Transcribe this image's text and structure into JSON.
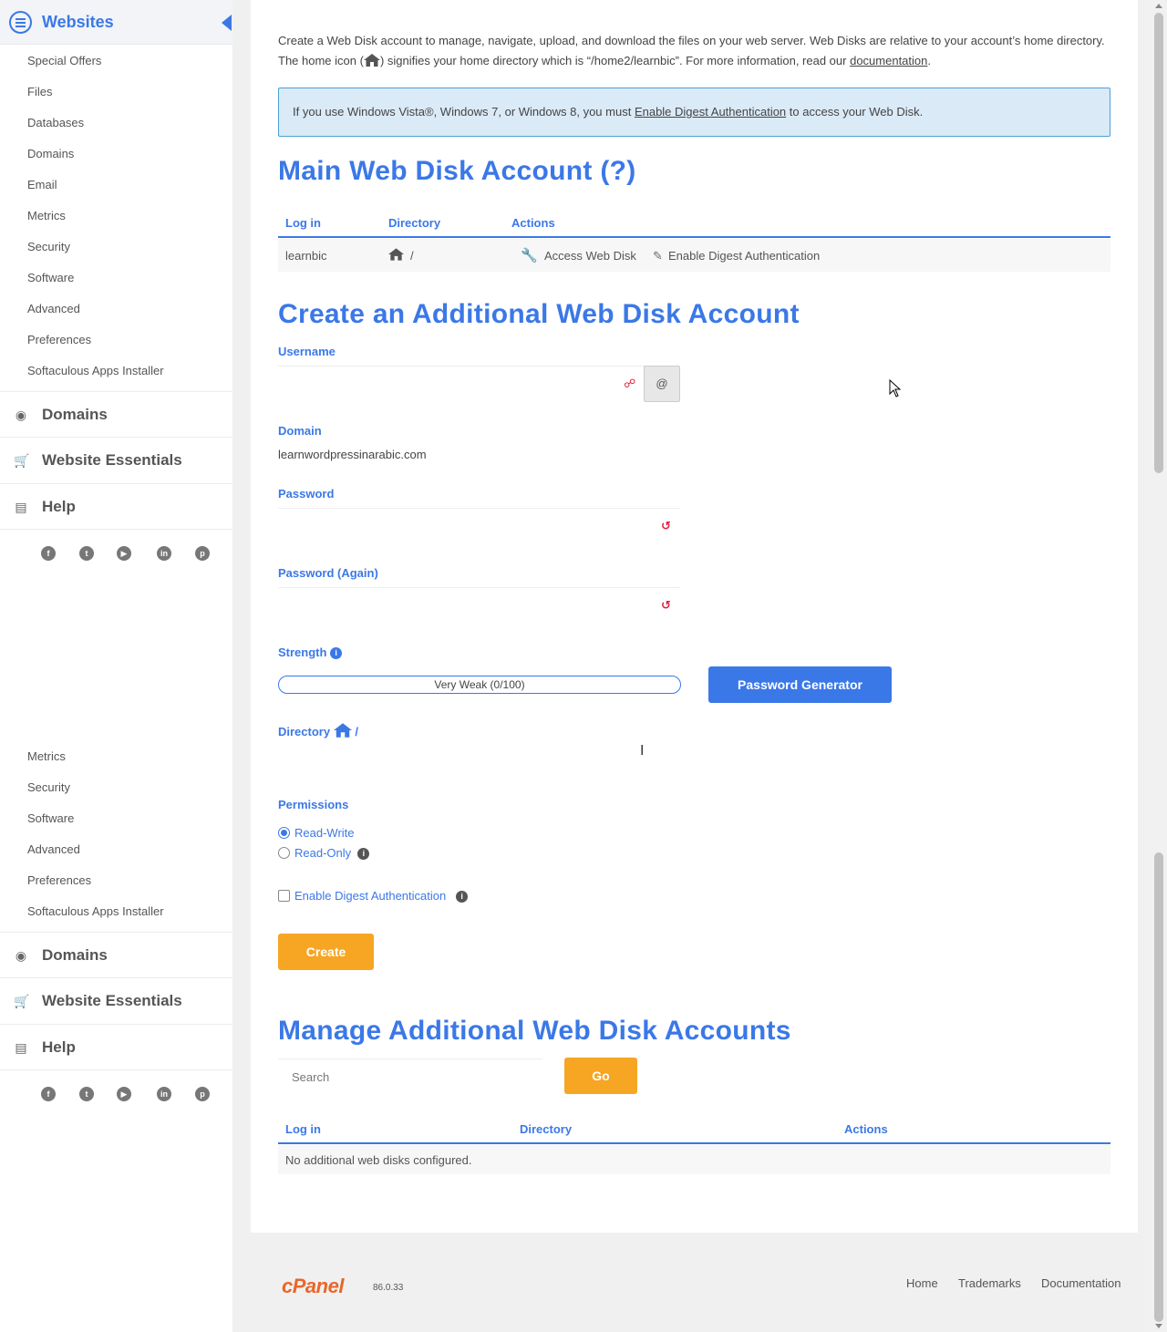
{
  "sidebar": {
    "header_title": "Websites",
    "sub_items_top": [
      "Special Offers",
      "Files",
      "Databases",
      "Domains",
      "Email",
      "Metrics",
      "Security",
      "Software",
      "Advanced",
      "Preferences",
      "Softaculous Apps Installer"
    ],
    "sub_items_bottom": [
      "Metrics",
      "Security",
      "Software",
      "Advanced",
      "Preferences",
      "Softaculous Apps Installer"
    ],
    "sections": {
      "domains": "Domains",
      "essentials": "Website Essentials",
      "help": "Help"
    },
    "social_icons": [
      "facebook-icon",
      "twitter-icon",
      "youtube-icon",
      "linkedin-icon",
      "pinterest-icon"
    ]
  },
  "intro": {
    "part1": "Create a Web Disk account to manage, navigate, upload, and download the files on your web server. Web Disks are relative to your account’s home directory. The home icon (",
    "part2": ") signifies your home directory which is “/home2/learnbic”. For more information, read our ",
    "doc_link": "documentation",
    "part3": "."
  },
  "alert": {
    "before": "If you use Windows Vista®, Windows 7, or Windows 8, you must ",
    "link": "Enable Digest Authentication",
    "after": " to access your Web Disk."
  },
  "main_account": {
    "heading": "Main Web Disk Account (?)",
    "columns": {
      "login": "Log in",
      "directory": "Directory",
      "actions": "Actions"
    },
    "row": {
      "login": "learnbic",
      "directory": "/",
      "access": "Access Web Disk",
      "digest": "Enable Digest Authentication"
    }
  },
  "create": {
    "heading": "Create an Additional Web Disk Account",
    "username_label": "Username",
    "username_value": "",
    "at_symbol": "@",
    "domain_label": "Domain",
    "domain_value": "learnwordpressinarabic.com",
    "password_label": "Password",
    "password_again_label": "Password (Again)",
    "strength_label": "Strength",
    "strength_text": "Very Weak (0/100)",
    "strength_value": 0,
    "generator_button": "Password Generator",
    "directory_label": "Directory",
    "directory_value": "/",
    "permissions_label": "Permissions",
    "perm_rw": "Read-Write",
    "perm_ro": "Read-Only",
    "digest_label": "Enable Digest Authentication",
    "create_button": "Create"
  },
  "manage": {
    "heading": "Manage Additional Web Disk Accounts",
    "search_placeholder": "Search",
    "go_button": "Go",
    "columns": {
      "login": "Log in",
      "directory": "Directory",
      "actions": "Actions"
    },
    "empty_text": "No additional web disks configured."
  },
  "footer": {
    "logo": "cPanel",
    "version": "86.0.33",
    "links": [
      "Home",
      "Trademarks",
      "Documentation"
    ]
  },
  "colors": {
    "accent": "#3b78e7",
    "orange": "#f6a623",
    "logo": "#e8672b"
  }
}
